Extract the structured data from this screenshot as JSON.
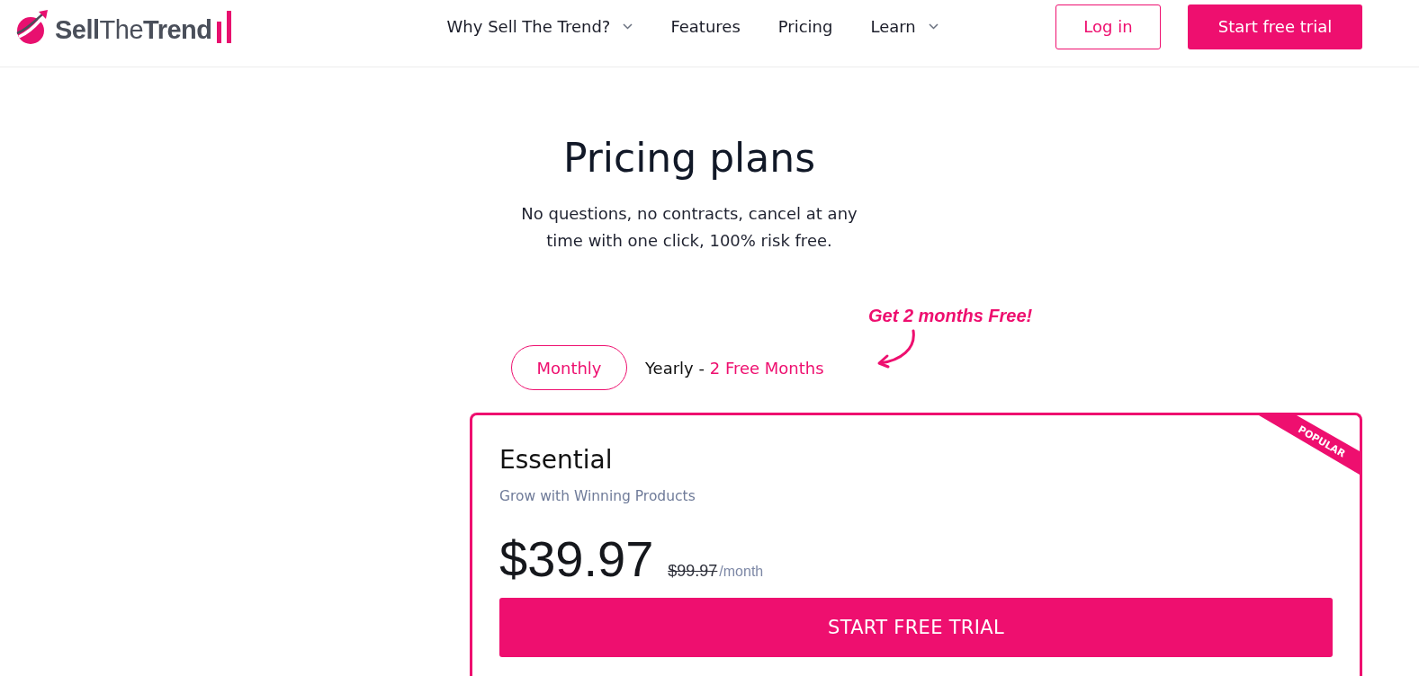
{
  "header": {
    "logo": "**Sell**The**Trend**",
    "nav": [
      {
        "label": "Why Sell The Trend?",
        "dropdown": true
      },
      {
        "label": "Features",
        "dropdown": false
      },
      {
        "label": "Pricing",
        "dropdown": false
      },
      {
        "label": "Learn",
        "dropdown": true
      }
    ],
    "login_button": "Log in",
    "trial_button": "Start free trial"
  },
  "hero": {
    "title": "Pricing plans",
    "subtitle": "No questions, no contracts, cancel at any time with one click, 100% risk free."
  },
  "billing_toggle": {
    "callout": "Get 2 months Free!",
    "options": [
      {
        "label": "Monthly",
        "selected": true
      },
      {
        "label": "Yearly -",
        "highlight": "2 Free Months",
        "selected": false
      }
    ]
  },
  "plan": {
    "name": "Essential",
    "tagline": "Grow with Winning Products",
    "price": "$39.97",
    "old_price": "$99.97",
    "period": "/month",
    "badge": "POPULAR",
    "button": "START FREE TRIAL"
  }
}
